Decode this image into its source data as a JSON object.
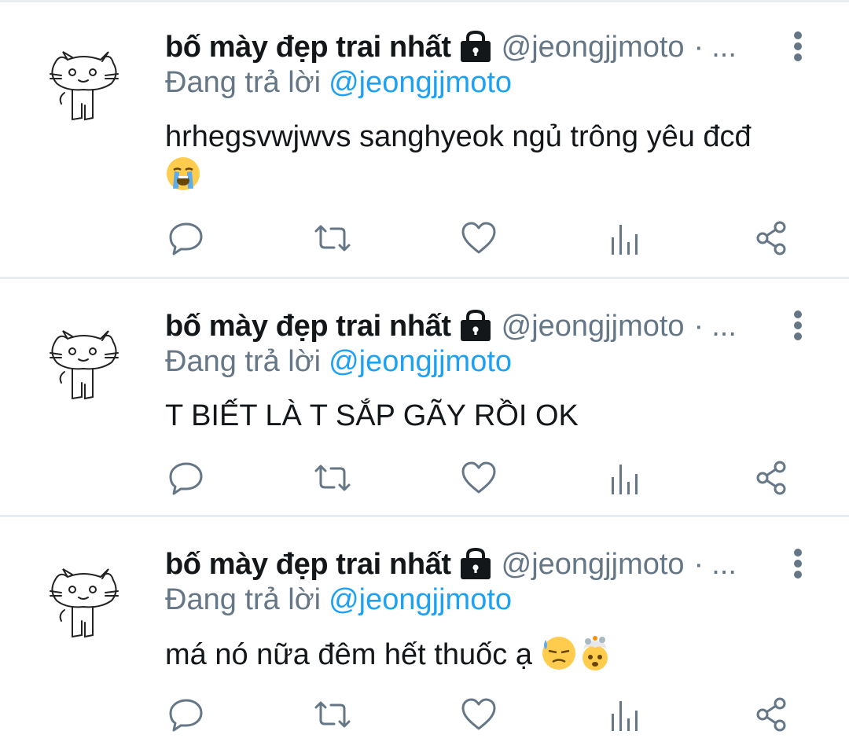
{
  "tweets": [
    {
      "author_name": "bố mày đẹp trai nhất",
      "handle": "@jeongjjmoto",
      "separator": "·",
      "overflow": "...",
      "reply_prefix": "Đang trả lời",
      "reply_to": "@jeongjjmoto",
      "text": "hrhegsvwjwvs sanghyeok ngủ trông yêu đcđ",
      "emojis": [
        "loudly-crying-face-emoji"
      ]
    },
    {
      "author_name": "bố mày đẹp trai nhất",
      "handle": "@jeongjjmoto",
      "separator": "·",
      "overflow": "...",
      "reply_prefix": "Đang trả lời",
      "reply_to": "@jeongjjmoto",
      "text": "T BIẾT LÀ T SẮP GÃY RỒI OK",
      "emojis": []
    },
    {
      "author_name": "bố mày đẹp trai nhất",
      "handle": "@jeongjjmoto",
      "separator": "·",
      "overflow": "...",
      "reply_prefix": "Đang trả lời",
      "reply_to": "@jeongjjmoto",
      "text": "má nó nữa đêm hết thuốc ạ",
      "emojis": [
        "downcast-sweat-face-emoji",
        "exploding-head-emoji"
      ]
    }
  ],
  "icons": {
    "lock": "lock-icon",
    "more": "more-vertical-icon",
    "reply": "reply-icon",
    "retweet": "retweet-icon",
    "like": "heart-icon",
    "analytics": "analytics-icon",
    "share": "share-icon"
  },
  "colors": {
    "text": "#14171a",
    "secondary": "#657786",
    "link": "#1da1f2",
    "icon": "#657786",
    "divider": "#e6ecf0"
  }
}
